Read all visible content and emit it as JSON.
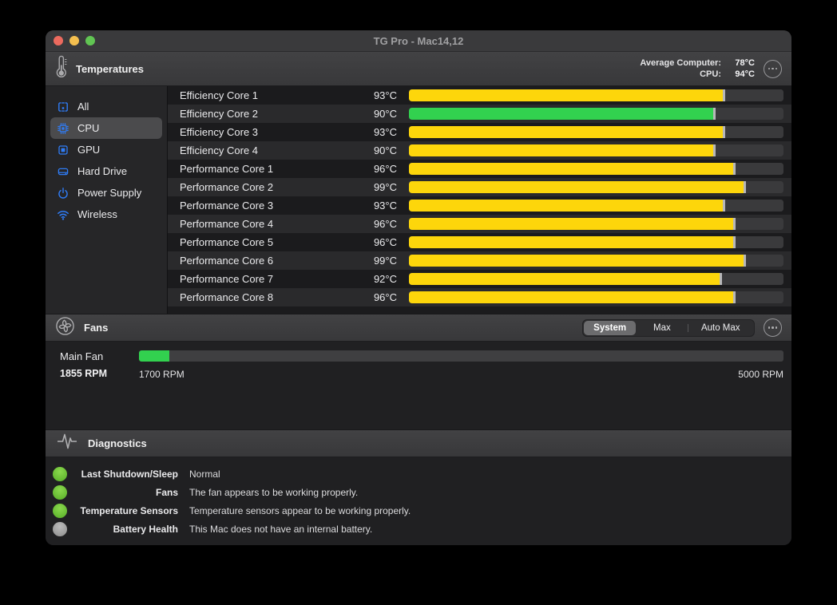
{
  "window": {
    "title": "TG Pro - Mac14,12",
    "controls": [
      "close",
      "minimize",
      "zoom"
    ]
  },
  "colors": {
    "traffic_close": "#ec6a5e",
    "traffic_minimize": "#f4bf4f",
    "traffic_zoom": "#61c553",
    "bar_yellow": "#fdd60b",
    "bar_green": "#32d14f",
    "status_green": "#6cc63a",
    "status_gray": "#a2a2a2",
    "sidebar_icon_blue": "#2f7cf6"
  },
  "temperatures": {
    "header": "Temperatures",
    "average_computer_label": "Average Computer:",
    "average_computer_value": "78°C",
    "cpu_label": "CPU:",
    "cpu_value": "94°C",
    "scale_max_celsius": 110,
    "sensors": [
      {
        "name": "Efficiency Core 1",
        "temp_label": "93°C",
        "value": 93,
        "color": "yellow"
      },
      {
        "name": "Efficiency Core 2",
        "temp_label": "90°C",
        "value": 90,
        "color": "green"
      },
      {
        "name": "Efficiency Core 3",
        "temp_label": "93°C",
        "value": 93,
        "color": "yellow"
      },
      {
        "name": "Efficiency Core 4",
        "temp_label": "90°C",
        "value": 90,
        "color": "yellow"
      },
      {
        "name": "Performance Core 1",
        "temp_label": "96°C",
        "value": 96,
        "color": "yellow"
      },
      {
        "name": "Performance Core 2",
        "temp_label": "99°C",
        "value": 99,
        "color": "yellow"
      },
      {
        "name": "Performance Core 3",
        "temp_label": "93°C",
        "value": 93,
        "color": "yellow"
      },
      {
        "name": "Performance Core 4",
        "temp_label": "96°C",
        "value": 96,
        "color": "yellow"
      },
      {
        "name": "Performance Core 5",
        "temp_label": "96°C",
        "value": 96,
        "color": "yellow"
      },
      {
        "name": "Performance Core 6",
        "temp_label": "99°C",
        "value": 99,
        "color": "yellow"
      },
      {
        "name": "Performance Core 7",
        "temp_label": "92°C",
        "value": 92,
        "color": "yellow"
      },
      {
        "name": "Performance Core 8",
        "temp_label": "96°C",
        "value": 96,
        "color": "yellow"
      }
    ]
  },
  "sidebar": {
    "items": [
      {
        "id": "all",
        "label": "All",
        "icon": "all-sensors-icon",
        "selected": false
      },
      {
        "id": "cpu",
        "label": "CPU",
        "icon": "cpu-chip-icon",
        "selected": true
      },
      {
        "id": "gpu",
        "label": "GPU",
        "icon": "gpu-icon",
        "selected": false
      },
      {
        "id": "hard-drive",
        "label": "Hard Drive",
        "icon": "hard-drive-icon",
        "selected": false
      },
      {
        "id": "power-supply",
        "label": "Power Supply",
        "icon": "power-icon",
        "selected": false
      },
      {
        "id": "wireless",
        "label": "Wireless",
        "icon": "wifi-icon",
        "selected": false
      }
    ]
  },
  "fans": {
    "header": "Fans",
    "modes": [
      {
        "label": "System",
        "selected": true
      },
      {
        "label": "Max",
        "selected": false
      },
      {
        "label": "Auto Max",
        "selected": false
      }
    ],
    "fan_name": "Main Fan",
    "current_rpm_label": "1855 RPM",
    "current_rpm": 1855,
    "min_rpm_label": "1700 RPM",
    "min_rpm": 1700,
    "max_rpm_label": "5000 RPM",
    "max_rpm": 5000
  },
  "diagnostics": {
    "header": "Diagnostics",
    "rows": [
      {
        "label": "Last Shutdown/Sleep",
        "value": "Normal",
        "status": "green"
      },
      {
        "label": "Fans",
        "value": "The fan appears to be working properly.",
        "status": "green"
      },
      {
        "label": "Temperature Sensors",
        "value": "Temperature sensors appear to be working properly.",
        "status": "green"
      },
      {
        "label": "Battery Health",
        "value": "This Mac does not have an internal battery.",
        "status": "gray"
      }
    ]
  }
}
